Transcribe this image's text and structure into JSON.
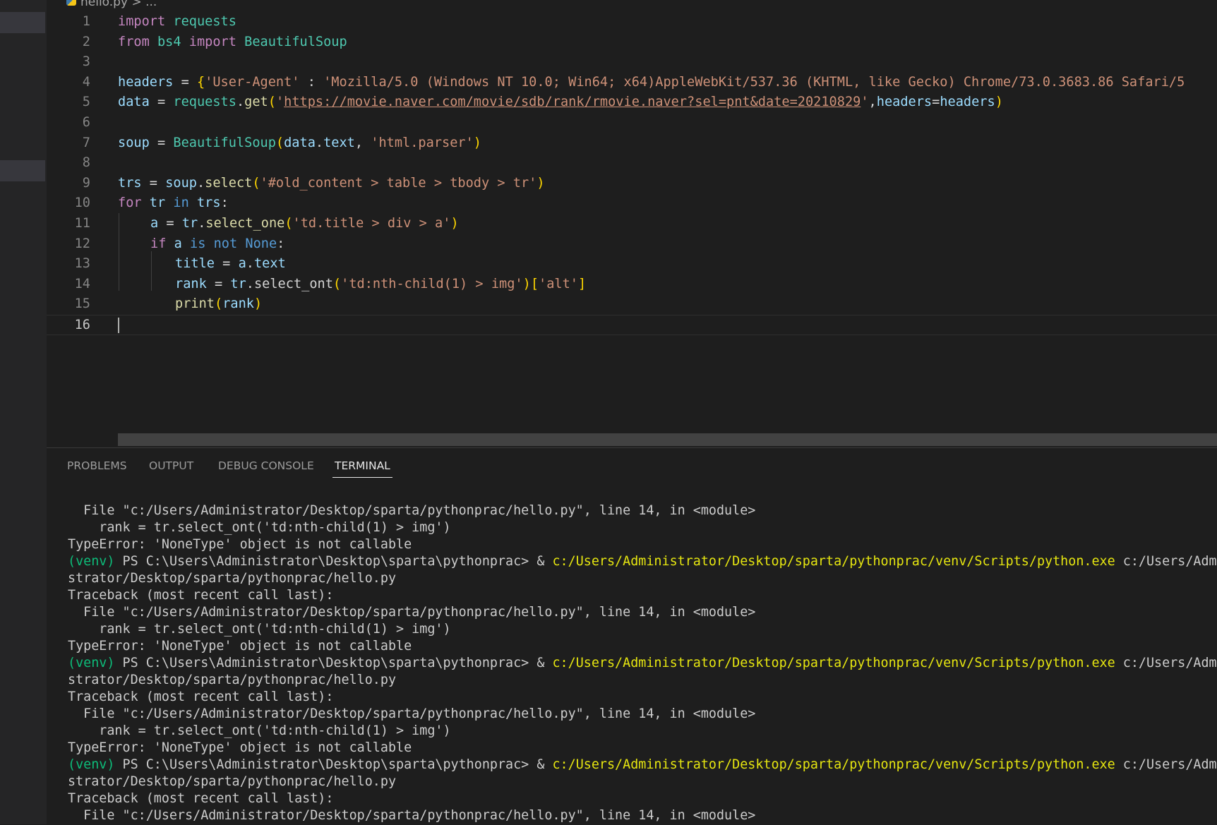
{
  "breadcrumb": {
    "file": "hello.py",
    "sep": ">",
    "more": "..."
  },
  "code_lines": [
    {
      "n": "1"
    },
    {
      "n": "2"
    },
    {
      "n": "3"
    },
    {
      "n": "4"
    },
    {
      "n": "5"
    },
    {
      "n": "6"
    },
    {
      "n": "7"
    },
    {
      "n": "8"
    },
    {
      "n": "9"
    },
    {
      "n": "10"
    },
    {
      "n": "11"
    },
    {
      "n": "12"
    },
    {
      "n": "13"
    },
    {
      "n": "14"
    },
    {
      "n": "15"
    },
    {
      "n": "16"
    }
  ],
  "code": {
    "l1": [
      "import",
      "requests"
    ],
    "l2": [
      "from",
      "bs4",
      "import",
      "BeautifulSoup"
    ],
    "l4": [
      "headers",
      " = ",
      "{",
      "'User-Agent'",
      " : ",
      "'Mozilla/5.0 (Windows NT 10.0; Win64; x64)AppleWebKit/537.36 (KHTML, like Gecko) Chrome/73.0.3683.86 Safari/5"
    ],
    "l5": [
      "data",
      " = ",
      "requests",
      ".",
      "get",
      "(",
      "'",
      "https://movie.naver.com/movie/sdb/rank/rmovie.naver?sel=pnt&date=20210829",
      "'",
      ",",
      "headers",
      "=",
      "headers",
      ")"
    ],
    "l7": [
      "soup",
      " = ",
      "BeautifulSoup",
      "(",
      "data",
      ".",
      "text",
      ", ",
      "'html.parser'",
      ")"
    ],
    "l9": [
      "trs",
      " = ",
      "soup",
      ".",
      "select",
      "(",
      "'#old_content > table > tbody > tr'",
      ")"
    ],
    "l10": [
      "for",
      " ",
      "tr",
      " ",
      "in",
      " ",
      "trs",
      ":"
    ],
    "l11": [
      "a",
      " = ",
      "tr",
      ".",
      "select_one",
      "(",
      "'td.title > div > a'",
      ")"
    ],
    "l12": [
      "if",
      " ",
      "a",
      " ",
      "is",
      " ",
      "not",
      " ",
      "None",
      ":"
    ],
    "l13": [
      "title",
      " = ",
      "a",
      ".",
      "text"
    ],
    "l14": [
      "rank",
      " = ",
      "tr",
      ".",
      "select_ont",
      "(",
      "'td:nth-child(1) > img'",
      ")",
      "[",
      "'alt'",
      "]"
    ],
    "l15": [
      "print",
      "(",
      "rank",
      ")"
    ]
  },
  "panel": {
    "tabs": [
      "PROBLEMS",
      "OUTPUT",
      "DEBUG CONSOLE",
      "TERMINAL"
    ],
    "active_tab": "TERMINAL"
  },
  "terminal": {
    "file_line": "  File \"c:/Users/Administrator/Desktop/sparta/pythonprac/hello.py\", line 14, in <module>",
    "rank_line": "    rank = tr.select_ont('td:nth-child(1) > img')",
    "error_line": "TypeError: 'NoneType' object is not callable",
    "venv": "(venv)",
    "prompt": " PS C:\\Users\\Administrator\\Desktop\\sparta\\pythonprac> & ",
    "exe": "c:/Users/Administrator/Desktop/sparta/pythonprac/venv/Scripts/python.exe",
    "arg": " c:/Users/Admi",
    "wrap": "strator/Desktop/sparta/pythonprac/hello.py",
    "traceback": "Traceback (most recent call last):"
  },
  "colors": {
    "keyword": "#c586c0",
    "module": "#4ec9b0",
    "variable": "#9cdcfe",
    "string": "#ce9178",
    "function": "#dcdcaa",
    "venv_green": "#0dbc79",
    "path_yellow": "#e5e510"
  }
}
